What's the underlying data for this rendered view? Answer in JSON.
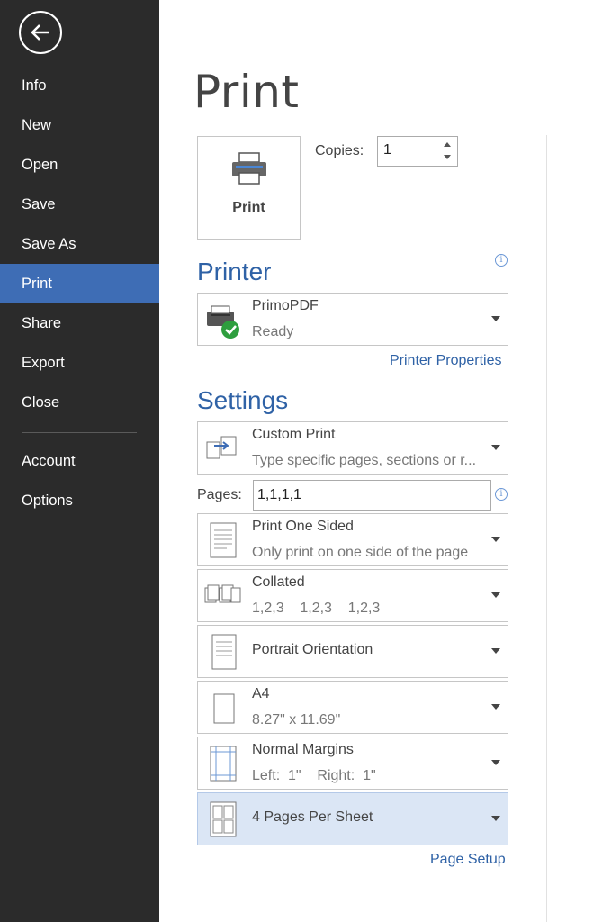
{
  "sidebar": {
    "back_icon": "back-arrow-icon",
    "items": [
      {
        "label": "Info"
      },
      {
        "label": "New"
      },
      {
        "label": "Open"
      },
      {
        "label": "Save"
      },
      {
        "label": "Save As"
      },
      {
        "label": "Print",
        "active": true
      },
      {
        "label": "Share"
      },
      {
        "label": "Export"
      },
      {
        "label": "Close"
      },
      {
        "label": "Account"
      },
      {
        "label": "Options"
      }
    ]
  },
  "main": {
    "title": "Print",
    "print_button": {
      "label": "Print",
      "icon": "printer-icon"
    },
    "copies": {
      "label": "Copies:",
      "value": "1"
    },
    "printer": {
      "heading": "Printer",
      "name": "PrimoPDF",
      "status": "Ready",
      "properties_link": "Printer Properties"
    },
    "settings": {
      "heading": "Settings",
      "range": {
        "title": "Custom Print",
        "subtitle": "Type specific pages, sections or r..."
      },
      "pages": {
        "label": "Pages:",
        "value": "1,1,1,1"
      },
      "sides": {
        "title": "Print One Sided",
        "subtitle": "Only print on one side of the page"
      },
      "collation": {
        "title": "Collated",
        "subtitle": "1,2,3    1,2,3    1,2,3"
      },
      "orientation": {
        "title": "Portrait Orientation"
      },
      "paper": {
        "title": "A4",
        "subtitle": "8.27\" x 11.69\""
      },
      "margins": {
        "title": "Normal Margins",
        "subtitle": "Left:  1\"    Right:  1\""
      },
      "per_sheet": {
        "title": "4 Pages Per Sheet"
      },
      "page_setup_link": "Page Setup"
    }
  },
  "colors": {
    "sidebar_bg": "#2b2b2b",
    "active_item": "#3e6db5",
    "heading_blue": "#2f62a6",
    "selected_bg": "#dbe6f5"
  }
}
